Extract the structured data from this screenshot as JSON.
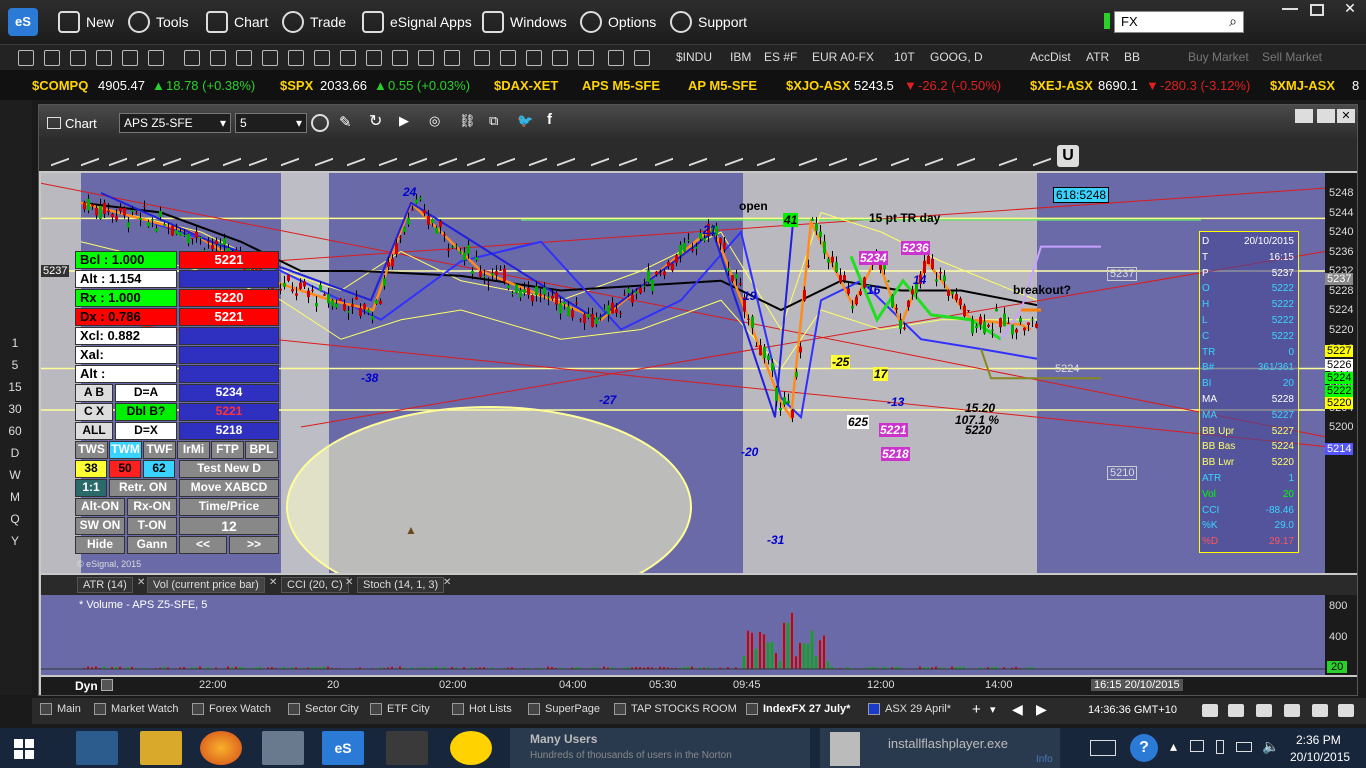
{
  "menu": {
    "items": [
      "New",
      "Tools",
      "Chart",
      "Trade",
      "eSignal Apps",
      "Windows",
      "Options",
      "Support"
    ],
    "search_value": "FX"
  },
  "toolbar_symbols": [
    "$INDU",
    "IBM",
    "ES #F",
    "EUR A0-FX",
    "10T",
    "GOOG, D",
    "AccDist",
    "ATR",
    "BB",
    "Buy Market",
    "Sell Market"
  ],
  "ticker": [
    {
      "sym": "$COMPQ",
      "price": "4905.47",
      "chg": "18.78 (+0.38%)",
      "dir": "up"
    },
    {
      "sym": "$SPX",
      "price": "2033.66",
      "chg": "0.55 (+0.03%)",
      "dir": "up"
    },
    {
      "sym": "$DAX-XET",
      "price": "",
      "chg": "",
      "dir": "none"
    },
    {
      "sym": "APS M5-SFE",
      "price": "",
      "chg": "",
      "dir": "none"
    },
    {
      "sym": "AP M5-SFE",
      "price": "",
      "chg": "",
      "dir": "none"
    },
    {
      "sym": "$XJO-ASX",
      "price": "5243.5",
      "chg": "-26.2 (-0.50%)",
      "dir": "down"
    },
    {
      "sym": "$XEJ-ASX",
      "price": "8690.1",
      "chg": "-280.3 (-3.12%)",
      "dir": "down"
    },
    {
      "sym": "$XMJ-ASX",
      "price": "8",
      "chg": "",
      "dir": "none"
    }
  ],
  "left_intervals": [
    "1",
    "5",
    "15",
    "30",
    "60",
    "D",
    "W",
    "M",
    "Q",
    "Y"
  ],
  "chart_window": {
    "title": "Chart",
    "symbol": "APS Z5-SFE",
    "interval": "5",
    "price_badge_left": "5237",
    "label_618": "618:5248",
    "annot_open": "open",
    "annot_tr": "15 pt TR day",
    "annot_breakout": "breakout?",
    "copyright": "© eSignal, 2015"
  },
  "y_ticks": [
    "5248",
    "5244",
    "5240",
    "5236",
    "5232",
    "5228",
    "5224",
    "5220",
    "5216",
    "5212",
    "5208",
    "5204",
    "5200"
  ],
  "right_badges": [
    {
      "v": "5237",
      "c": "#888888"
    },
    {
      "v": "5227",
      "c": "#ffff00"
    },
    {
      "v": "5226",
      "c": "#ffffff"
    },
    {
      "v": "5224",
      "c": "#00ff00"
    },
    {
      "v": "5222",
      "c": "#00ff00"
    },
    {
      "v": "5220",
      "c": "#ffff00"
    },
    {
      "v": "5214",
      "c": "#5555ff"
    }
  ],
  "wave_labels": [
    {
      "t": "24",
      "c": "#0000cc"
    },
    {
      "t": "-38",
      "c": "#0000cc"
    },
    {
      "t": "-27",
      "c": "#0000cc"
    },
    {
      "t": "21",
      "c": "#0000cc"
    },
    {
      "t": "19",
      "c": "#0000cc"
    },
    {
      "t": "-20",
      "c": "#0000cc"
    },
    {
      "t": "-31",
      "c": "#0000cc"
    },
    {
      "t": "41",
      "c": "#000000"
    },
    {
      "t": "-25",
      "c": "#000000"
    },
    {
      "t": "16",
      "c": "#0000cc"
    },
    {
      "t": "17",
      "c": "#000000"
    },
    {
      "t": "-13",
      "c": "#0000cc"
    },
    {
      "t": "14",
      "c": "#0000cc"
    },
    {
      "t": "5234",
      "c": "#ffffff"
    },
    {
      "t": "5236",
      "c": "#ffffff"
    },
    {
      "t": "5221",
      "c": "#ffffff"
    },
    {
      "t": "5218",
      "c": "#ffffff"
    },
    {
      "t": "625",
      "c": "#000000"
    },
    {
      "t": "15.20",
      "c": "#000000"
    },
    {
      "t": "107.1 %",
      "c": "#000000"
    },
    {
      "t": "5220",
      "c": "#000000"
    }
  ],
  "right_lines": {
    "l5224": "5224",
    "l5237": "5237",
    "l5210": "5210"
  },
  "ratio_panel": {
    "rows": [
      {
        "k": "Bcl : 1.000",
        "v": "5221",
        "kc": "#00ff00",
        "vc": "#ff0000"
      },
      {
        "k": "Alt :  1.154",
        "v": "",
        "kc": "#ffffff",
        "vc": "#3030c0"
      },
      {
        "k": "Rx :  1.000",
        "v": "5220",
        "kc": "#00ff00",
        "vc": "#ff0000"
      },
      {
        "k": "Dx :  0.786",
        "v": "5221",
        "kc": "#ff0000",
        "vc": "#ff0000"
      },
      {
        "k": "Xcl:  0.882",
        "v": "",
        "kc": "#ffffff",
        "vc": "#3030c0"
      },
      {
        "k": "Xal:",
        "v": "",
        "kc": "#ffffff",
        "vc": "#3030c0"
      },
      {
        "k": "Alt :",
        "v": "",
        "kc": "#ffffff",
        "vc": "#3030c0"
      }
    ],
    "ab": "A  B",
    "ab_label": "D=A",
    "ab_val": "5234",
    "cx": "C  X",
    "cx_label": "Dbl B?",
    "cx_val": "5221",
    "all": "ALL",
    "all_label": "D=X",
    "all_val": "5218",
    "tws": [
      "TWS",
      "TWM",
      "TWF",
      "IrMi",
      "FTP",
      "BPL"
    ],
    "nums": [
      "38",
      "50",
      "62"
    ],
    "test_new": "Test New D",
    "b11": "1:1",
    "retr": "Retr. ON",
    "move": "Move XABCD",
    "alt_on": "Alt-ON",
    "rx_on": "Rx-ON",
    "time_price": "Time/Price",
    "sw_on": "SW ON",
    "t_on": "T-ON",
    "twelve": "12",
    "hide": "Hide",
    "gann": "Gann",
    "prev": "<<",
    "next": ">>"
  },
  "data_window": {
    "date": "20/10/2015",
    "rows": [
      {
        "k": "D",
        "v": "20/10/2015"
      },
      {
        "k": "T",
        "v": "16:15"
      },
      {
        "k": "P",
        "v": "5237"
      },
      {
        "k": "O",
        "v": "5222"
      },
      {
        "k": "H",
        "v": "5222"
      },
      {
        "k": "L",
        "v": "5222"
      },
      {
        "k": "C",
        "v": "5222"
      },
      {
        "k": "TR",
        "v": "0"
      },
      {
        "k": "B#",
        "v": "361/361"
      },
      {
        "k": "BI",
        "v": "20"
      },
      {
        "k": "MA",
        "v": "5228"
      },
      {
        "k": "MA",
        "v": "5227"
      },
      {
        "k": "BB Upr",
        "v": "5227"
      },
      {
        "k": "BB Bas",
        "v": "5224"
      },
      {
        "k": "BB Lwr",
        "v": "5220"
      },
      {
        "k": "ATR",
        "v": "1"
      },
      {
        "k": "Vol",
        "v": "20"
      },
      {
        "k": "CCI",
        "v": "-88.46"
      },
      {
        "k": "%K",
        "v": "29.0"
      },
      {
        "k": "%D",
        "v": "29.17"
      }
    ]
  },
  "indicator_tabs": [
    "ATR (14)",
    "Vol (current price bar)",
    "CCI (20, C)",
    "Stoch (14, 1, 3)"
  ],
  "volume_label": "* Volume - APS Z5-SFE, 5",
  "volume_ticks": [
    "800",
    "400",
    "0"
  ],
  "volume_badge": "20",
  "time_axis": {
    "dyn": "Dyn",
    "ticks": [
      "22:00",
      "20",
      "02:00",
      "04:00",
      "05:30",
      "09:45",
      "12:00",
      "14:00"
    ],
    "cursor": "16:15 20/10/2015"
  },
  "workspace_tabs": [
    "Main",
    "Market Watch",
    "Forex Watch",
    "Sector City",
    "ETF City",
    "Hot Lists",
    "SuperPage",
    "TAP STOCKS ROOM",
    "IndexFX 27 July*",
    "ASX 29 April*"
  ],
  "status_time": "14:36:36 GMT+10",
  "taskbar": {
    "notif_title": "Many Users",
    "notif_sub": "Hundreds of thousands of users in the Norton",
    "download": "installflashplayer.exe",
    "download_sub": "Info",
    "clock_time": "2:36 PM",
    "clock_date": "20/10/2015"
  }
}
